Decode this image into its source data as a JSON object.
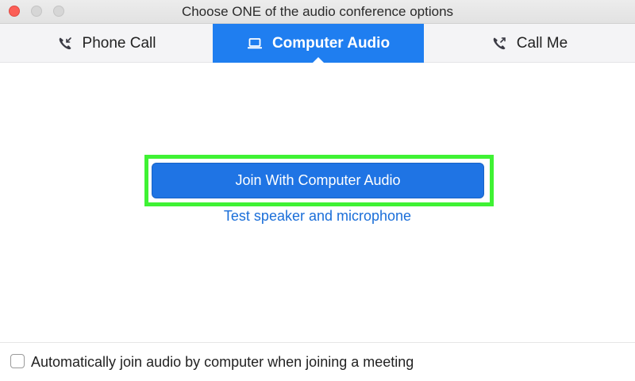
{
  "window": {
    "title": "Choose ONE of the audio conference options"
  },
  "tabs": [
    {
      "label": "Phone Call",
      "icon": "phone-incoming-icon",
      "selected": false
    },
    {
      "label": "Computer Audio",
      "icon": "laptop-icon",
      "selected": true
    },
    {
      "label": "Call Me",
      "icon": "phone-outgoing-icon",
      "selected": false
    }
  ],
  "main": {
    "join_button_label": "Join With Computer Audio",
    "test_link_label": "Test speaker and microphone"
  },
  "footer": {
    "auto_join_label": "Automatically join audio by computer when joining a meeting",
    "auto_join_checked": false
  },
  "colors": {
    "accent": "#1f7ef0",
    "button": "#1f74e4",
    "link": "#1a6ed9",
    "highlight": "#3ff234"
  }
}
